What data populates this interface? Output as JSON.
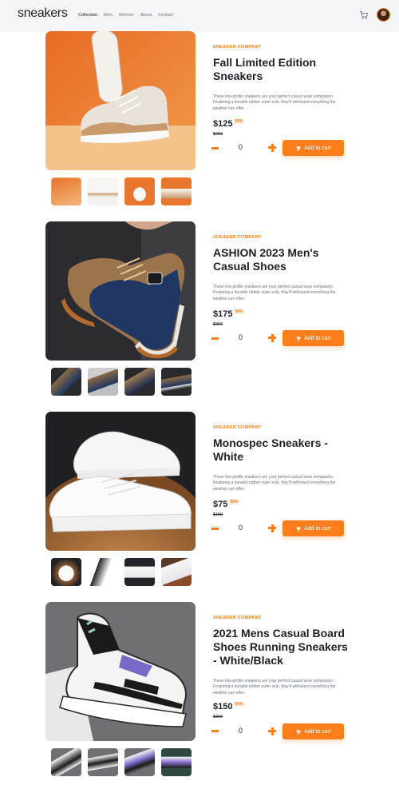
{
  "header": {
    "logo": "sneakers",
    "nav": [
      "Collection",
      "Men",
      "Women",
      "About",
      "Contact"
    ],
    "cart_icon": "cart-icon",
    "avatar_icon": "avatar"
  },
  "colors": {
    "accent": "#ff7e1b",
    "dark": "#1d2026",
    "muted": "#69707d"
  },
  "products": [
    {
      "company": "SNEAKER COMPANY",
      "title": "Fall Limited Edition Sneakers",
      "description": "These low-profile sneakers are your perfect casual wear companion. Featuring a durable rubber outer sole, they’ll withstand everything the weather can offer.",
      "price": "$125",
      "discount": "50%",
      "old_price": "$250",
      "quantity": "0",
      "add_to_cart": "Add to cart"
    },
    {
      "company": "SNEAKER COMPANY",
      "title": "ASHION 2023 Men's Casual Shoes",
      "description": "These low-profile sneakers are your perfect casual wear companion. Featuring a durable rubber outer sole, they’ll withstand everything the weather can offer.",
      "price": "$175",
      "discount": "50%",
      "old_price": "$350",
      "quantity": "0",
      "add_to_cart": "Add to cart"
    },
    {
      "company": "SNEAKER COMPANY",
      "title": "Monospec Sneakers - White",
      "description": "These low-profile sneakers are your perfect casual wear companion. Featuring a durable rubber outer sole, they’ll withstand everything the weather can offer.",
      "price": "$75",
      "discount": "50%",
      "old_price": "$150",
      "quantity": "0",
      "add_to_cart": "Add to cart"
    },
    {
      "company": "SNEAKER COMPANY",
      "title": "2021 Mens Casual Board Shoes Running Sneakers - White/Black",
      "description": "These low-profile sneakers are your perfect casual wear companion. Featuring a durable rubber outer sole, they’ll withstand everything the weather can offer.",
      "price": "$150",
      "discount": "50%",
      "old_price": "$300",
      "quantity": "0",
      "add_to_cart": "Add to cart"
    }
  ]
}
